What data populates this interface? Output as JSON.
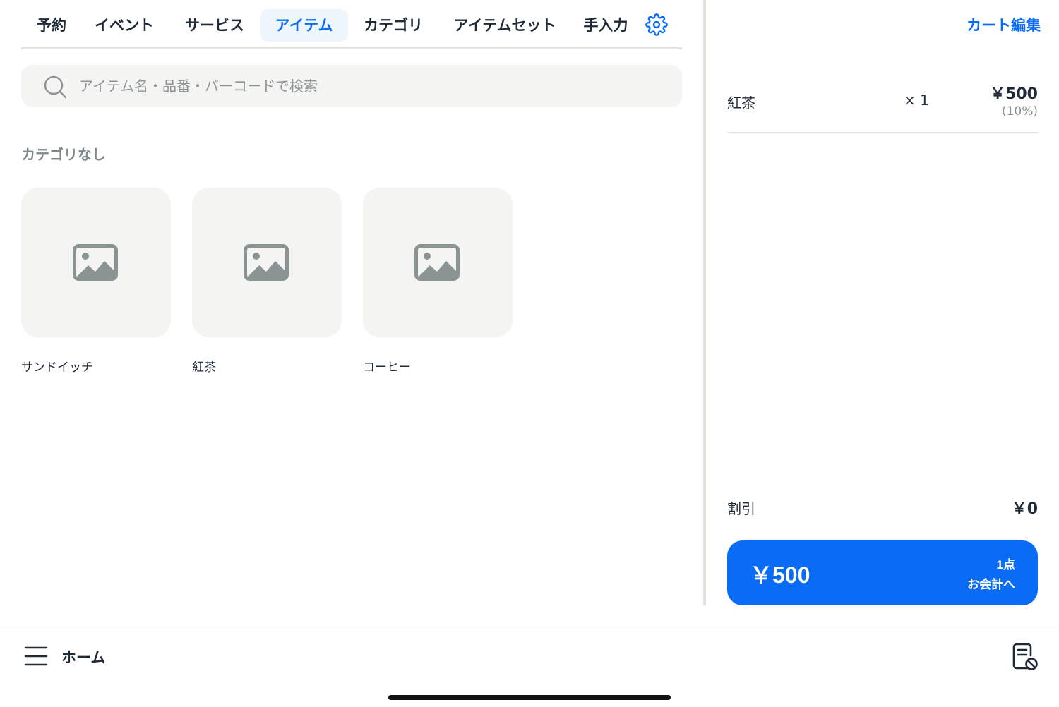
{
  "tabs": [
    {
      "label": "予約",
      "active": false
    },
    {
      "label": "イベント",
      "active": false
    },
    {
      "label": "サービス",
      "active": false
    },
    {
      "label": "アイテム",
      "active": true
    },
    {
      "label": "カテゴリ",
      "active": false
    },
    {
      "label": "アイテムセット",
      "active": false
    },
    {
      "label": "手入力",
      "active": false
    }
  ],
  "search": {
    "placeholder": "アイテム名・品番・バーコードで検索",
    "value": ""
  },
  "section_title": "カテゴリなし",
  "items": [
    {
      "name": "サンドイッチ"
    },
    {
      "name": "紅茶"
    },
    {
      "name": "コーヒー"
    }
  ],
  "cart": {
    "edit_label": "カート編集",
    "lines": [
      {
        "name": "紅茶",
        "qty": "× 1",
        "price": "￥500",
        "tax": "(10%)"
      }
    ],
    "discount_label": "割引",
    "discount_value": "￥0",
    "checkout": {
      "total": "￥500",
      "count": "1点",
      "label": "お会計へ"
    }
  },
  "bottom": {
    "home_label": "ホーム"
  },
  "colors": {
    "accent": "#0a6cf5",
    "accent_tint": "#edf5fd",
    "placeholder_bg": "#f4f4f2",
    "muted_text": "#7e8789"
  },
  "icons": {
    "settings": "gear-icon",
    "search": "search-icon",
    "placeholder": "image-placeholder-icon",
    "menu": "hamburger-menu-icon",
    "receipt": "receipt-disabled-icon"
  }
}
